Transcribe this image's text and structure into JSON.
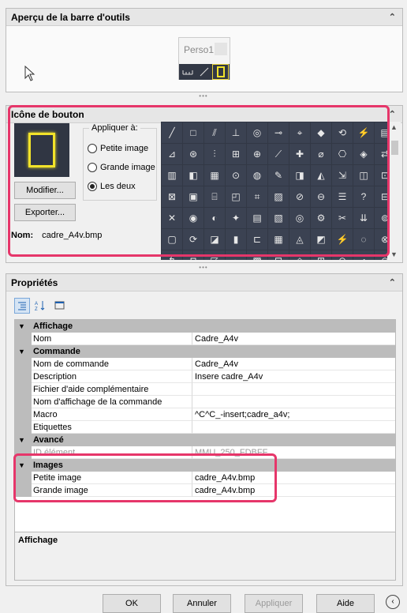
{
  "preview": {
    "title": "Aperçu de la barre d'outils",
    "toolbar_name": "Perso1",
    "collapse": "⌃"
  },
  "icon_panel": {
    "title": "Icône de bouton",
    "collapse": "⌃",
    "modify_label": "Modifier...",
    "export_label": "Exporter...",
    "apply_legend": "Appliquer à:",
    "radio_small": "Petite image",
    "radio_large": "Grande image",
    "radio_both": "Les deux",
    "selected_radio": "Les deux",
    "name_label": "Nom:",
    "name_value": "cadre_A4v.bmp",
    "grid_icons": [
      "╱",
      "□",
      "⫽",
      "⊥",
      "◎",
      "⊸",
      "⌖",
      "◆",
      "⟲",
      "⚡",
      "▤",
      "⊿",
      "⊛",
      "⫶",
      "⊞",
      "⊕",
      "⟋",
      "✚",
      "⌀",
      "⎔",
      "◈",
      "⇄",
      "▥",
      "◧",
      "▦",
      "⊙",
      "◍",
      "✎",
      "◨",
      "◭",
      "⇲",
      "◫",
      "⊡",
      "⊠",
      "▣",
      "⌸",
      "◰",
      "⌗",
      "▨",
      "⊘",
      "⊖",
      "☰",
      "?",
      "⊟",
      "✕",
      "◉",
      "◐",
      "✦",
      "▤",
      "▧",
      "◎",
      "⚙",
      "✂",
      "⇊",
      "⊚",
      "▢",
      "⟳",
      "◪",
      "▮",
      "⊏",
      "▦",
      "◬",
      "◩",
      "⚡",
      "◌",
      "⊗",
      "↰",
      "⊓",
      "◸",
      "◒",
      "▩",
      "⊡",
      "◇",
      "⊞",
      "⊝",
      "◑",
      "⊜",
      "⁂",
      "⌒",
      "◜"
    ]
  },
  "properties": {
    "title": "Propriétés",
    "collapse": "⌃",
    "categories": {
      "affichage": "Affichage",
      "commande": "Commande",
      "avance": "Avancé",
      "images": "Images"
    },
    "rows": {
      "nom": {
        "k": "Nom",
        "v": "Cadre_A4v"
      },
      "nom_commande": {
        "k": "Nom de commande",
        "v": "Cadre_A4v"
      },
      "description": {
        "k": "Description",
        "v": "Insere cadre_A4v"
      },
      "aide": {
        "k": "Fichier d'aide complémentaire",
        "v": ""
      },
      "nom_affichage": {
        "k": "Nom d'affichage de la commande",
        "v": ""
      },
      "macro": {
        "k": "Macro",
        "v": "^C^C_-insert;cadre_a4v;"
      },
      "etiquettes": {
        "k": "Etiquettes",
        "v": ""
      },
      "id": {
        "k": "ID élément",
        "v": "MMU_250_FDBFF"
      },
      "petite": {
        "k": "Petite image",
        "v": "cadre_A4v.bmp"
      },
      "grande": {
        "k": "Grande image",
        "v": "cadre_A4v.bmp"
      }
    },
    "description_title": "Affichage"
  },
  "footer": {
    "ok": "OK",
    "cancel": "Annuler",
    "apply": "Appliquer",
    "help": "Aide",
    "nav": "‹"
  },
  "colors": {
    "highlight": "#e6366a",
    "icon_bg": "#323845",
    "frame": "#f2e32a"
  }
}
